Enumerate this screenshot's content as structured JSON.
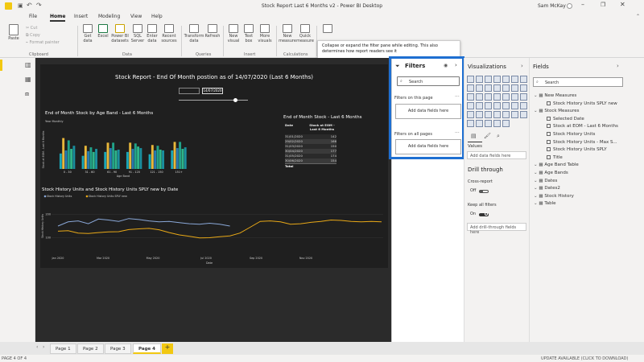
{
  "window": {
    "title": "Stock Report Last 6 Months v2 - Power BI Desktop",
    "user": "Sam McKay"
  },
  "menu": {
    "file": "File",
    "home": "Home",
    "insert": "Insert",
    "modeling": "Modeling",
    "view": "View",
    "help": "Help"
  },
  "ribbon": {
    "clipboard": {
      "paste": "Paste",
      "cut": "Cut",
      "copy": "Copy",
      "format_painter": "Format painter",
      "label": "Clipboard"
    },
    "data": {
      "get_data": "Get data",
      "excel": "Excel",
      "pbi_datasets": "Power BI datasets",
      "sql": "SQL Server",
      "enter_data": "Enter data",
      "recent": "Recent sources",
      "label": "Data"
    },
    "queries": {
      "transform": "Transform data",
      "refresh": "Refresh",
      "label": "Queries"
    },
    "insert": {
      "new_visual": "New visual",
      "text_box": "Text box",
      "more_visuals": "More visuals",
      "label": "Insert"
    },
    "calculations": {
      "new_measure": "New measure",
      "quick_measure": "Quick measure",
      "label": "Calculations"
    }
  },
  "tooltip": {
    "text": "Collapse or expand the filter pane while editing. This also determines how report readers see it"
  },
  "report": {
    "title": "Stock Report - End Of Month postion as of 14/07/2020 (Last 6 Months)",
    "slicer_start": "",
    "slicer_end": "14/07/2020",
    "bar_chart": {
      "title": "End of Month Stock by Age Band - Last 6 Months",
      "legend_label": "Year Monthly"
    },
    "table": {
      "title": "End of Month Stock - Last 6 Months",
      "col_date": "Date",
      "col_stock": "Stock at EOM - Last 6 Months",
      "rows": [
        {
          "date": "31/01/2020",
          "value": "142"
        },
        {
          "date": "29/02/2020",
          "value": "166"
        },
        {
          "date": "31/03/2020",
          "value": "150"
        },
        {
          "date": "30/04/2020",
          "value": "177"
        },
        {
          "date": "31/05/2020",
          "value": "174"
        },
        {
          "date": "30/06/2020",
          "value": "154"
        }
      ],
      "total_label": "Total"
    },
    "line_chart": {
      "title": "Stock History Units and Stock History Units SPLY new by Date"
    }
  },
  "chart_data": [
    {
      "type": "bar",
      "title": "End of Month Stock by Age Band - Last 6 Months",
      "xlabel": "Age Band",
      "ylabel": "Stock at EOM - Last 6 Months",
      "categories": [
        "0 - 30",
        "31 - 60",
        "61 - 90",
        "91 - 120",
        "121 - 150",
        "151+"
      ],
      "ylim": [
        0,
        50
      ],
      "series": [
        {
          "name": "2020-01",
          "color": "#1aa7b8",
          "values": [
            20,
            17,
            22,
            22,
            19,
            24
          ]
        },
        {
          "name": "2020-02",
          "color": "#e8b73a",
          "values": [
            40,
            30,
            34,
            34,
            31,
            35
          ]
        },
        {
          "name": "2020-03",
          "color": "#2a7ab0",
          "values": [
            24,
            23,
            27,
            26,
            24,
            27
          ]
        },
        {
          "name": "2020-04",
          "color": "#21a389",
          "values": [
            37,
            28,
            34,
            33,
            30,
            35
          ]
        },
        {
          "name": "2020-05",
          "color": "#2fb58a",
          "values": [
            26,
            22,
            24,
            29,
            25,
            26
          ]
        },
        {
          "name": "2020-06",
          "color": "#1a8f9e",
          "values": [
            30,
            26,
            25,
            27,
            24,
            28
          ]
        }
      ]
    },
    {
      "type": "line",
      "title": "Stock History Units and Stock History Units SPLY new by Date",
      "xlabel": "Date",
      "ylabel": "Stock History Units",
      "xticks": [
        "Jan 2020",
        "Mar 2020",
        "May 2020",
        "Jul 2020",
        "Sep 2020",
        "Nov 2020"
      ],
      "yticks": [
        100,
        200
      ],
      "ylim": [
        50,
        250
      ],
      "series": [
        {
          "name": "Stock History Units",
          "color": "#8aa8d8",
          "values": [
            150,
            168,
            172,
            160,
            180,
            176,
            170,
            182,
            178,
            172,
            168,
            170,
            165,
            160,
            158,
            162,
            158,
            150
          ]
        },
        {
          "name": "Stock History Units SPLY new",
          "color": "#e8a817",
          "values": [
            128,
            130,
            120,
            118,
            122,
            125,
            126,
            135,
            138,
            140,
            134,
            122,
            112,
            106,
            99,
            100,
            104,
            108,
            120,
            145,
            170,
            172,
            168,
            158,
            160,
            166,
            170,
            176,
            174,
            170,
            168,
            170,
            168
          ]
        }
      ]
    }
  ],
  "filters": {
    "title": "Filters",
    "search": "Search",
    "on_page": "Filters on this page",
    "on_page_add": "Add data fields here",
    "all_pages": "Filters on all pages",
    "all_pages_add": "Add data fields here"
  },
  "visualizations": {
    "title": "Visualizations",
    "values": "Values",
    "values_add": "Add data fields here",
    "drill": "Drill through",
    "cross_report": "Cross-report",
    "off": "Off",
    "keep_all": "Keep all filters",
    "on": "On",
    "drill_add": "Add drill-through fields here"
  },
  "fields": {
    "title": "Fields",
    "search": "Search",
    "items": [
      {
        "label": "New Measures",
        "level": 0
      },
      {
        "label": "Stock History Units SPLY new",
        "level": 1
      },
      {
        "label": "Stock Measures",
        "level": 0
      },
      {
        "label": "Selected Date",
        "level": 1
      },
      {
        "label": "Stock at EOM - Last 6 Months",
        "level": 1
      },
      {
        "label": "Stock History Units",
        "level": 1
      },
      {
        "label": "Stock History Units - Max S...",
        "level": 1
      },
      {
        "label": "Stock History Units SPLY",
        "level": 1
      },
      {
        "label": "Title",
        "level": 1
      },
      {
        "label": "Age Band Table",
        "level": 0
      },
      {
        "label": "Age Bands",
        "level": 0
      },
      {
        "label": "Dates",
        "level": 0
      },
      {
        "label": "Dates2",
        "level": 0
      },
      {
        "label": "Stock History",
        "level": 0
      },
      {
        "label": "Table",
        "level": 0
      }
    ]
  },
  "pages": {
    "p1": "Page 1",
    "p2": "Page 2",
    "p3": "Page 3",
    "p4": "Page 4",
    "add": "+"
  },
  "status": {
    "left": "PAGE 4 OF 4",
    "right": "UPDATE AVAILABLE (CLICK TO DOWNLOAD)"
  }
}
